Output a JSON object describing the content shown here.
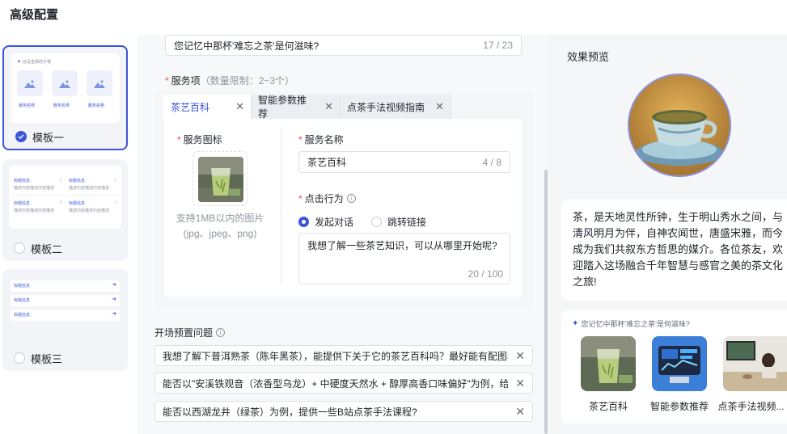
{
  "page": {
    "title": "高级配置"
  },
  "templates": {
    "items": [
      {
        "label": "模板一",
        "selected": true
      },
      {
        "label": "模板二",
        "selected": false
      },
      {
        "label": "模板三",
        "selected": false
      }
    ],
    "preview1": {
      "header": "这是金牌助手哦",
      "item_label": "服务名称"
    },
    "preview2": {
      "title": "标题信息",
      "desc": "描述内容描述内容描述"
    },
    "preview3": {
      "title": "标题信息"
    }
  },
  "top_question": {
    "value": "您记忆中那杯'难忘之茶'是何滋味?",
    "counter": "17 / 23"
  },
  "services": {
    "label": "服务项",
    "hint": "（数量限制：2~3个）",
    "tabs": [
      {
        "label": "茶艺百科",
        "active": true
      },
      {
        "label": "智能参数推荐",
        "active": false
      },
      {
        "label": "点茶手法视频指南",
        "active": false
      }
    ],
    "icon_label": "服务图标",
    "icon_hint_line1": "支持1MB以内的图片",
    "icon_hint_line2": "(jpg、jpeg、png)",
    "name_label": "服务名称",
    "name_value": "茶艺百科",
    "name_counter": "4 / 8",
    "action_label": "点击行为",
    "action_options": [
      "发起对话",
      "跳转链接"
    ],
    "action_selected": "发起对话",
    "message_value": "我想了解一些茶艺知识，可以从哪里开始呢?",
    "message_counter": "20 / 100"
  },
  "opening_questions": {
    "label": "开场预置问题",
    "items": [
      "我想了解下普洱熟茶（陈年黑茶），能提供下关于它的茶艺百科吗？最好能有配图和",
      "能否以\"安溪铁观音（浓香型乌龙）+ 中硬度天然水 + 醇厚高香口味偏好\"为例，给我",
      "能否以西湖龙井（绿茶）为例，提供一些B站点茶手法课程?"
    ]
  },
  "preview": {
    "title": "效果预览",
    "intro": "茶，是天地灵性所钟，生于明山秀水之间，与清风明月为伴，自神农闻世，唐盛宋雅，而今成为我们共叙东方哲思的媒介。各位茶友，欢迎踏入这场融合千年智慧与感官之美的茶文化之旅!",
    "question": "您记忆中那杯'难忘之茶'是何滋味?",
    "services": [
      "茶艺百科",
      "智能参数推荐",
      "点茶手法视频..."
    ]
  },
  "colors": {
    "accent": "#3b54d9",
    "required": "#f54a45"
  }
}
